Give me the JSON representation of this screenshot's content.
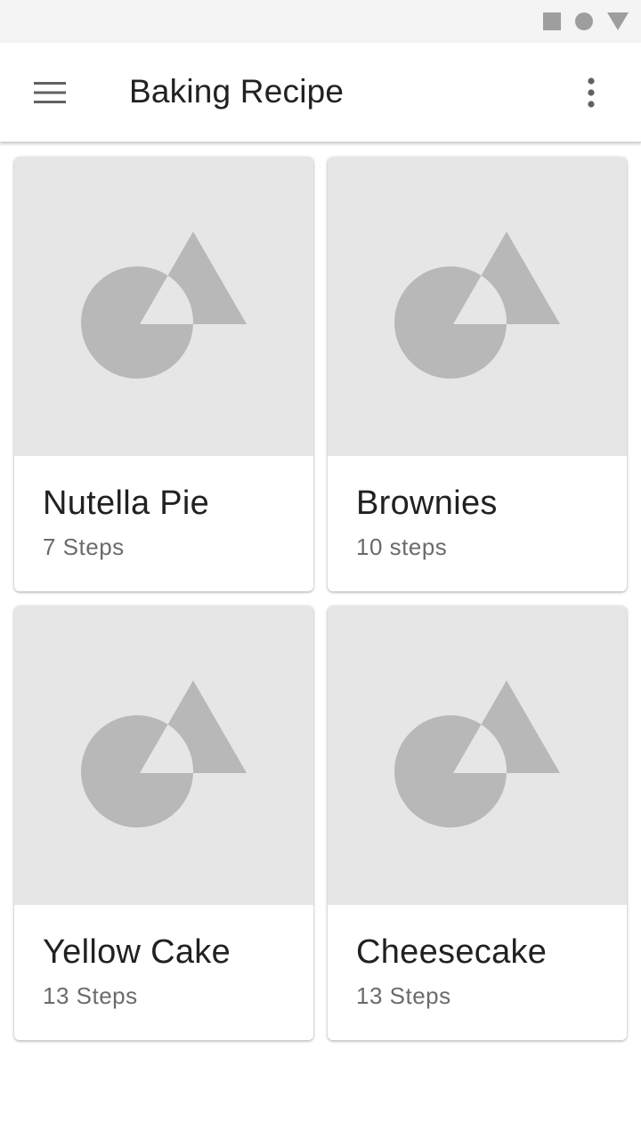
{
  "status_bar": {
    "icons": [
      "square-icon",
      "circle-icon",
      "triangle-icon"
    ],
    "icon_color": "#9e9e9e"
  },
  "app_bar": {
    "title": "Baking Recipe",
    "menu_icon": "hamburger-menu-icon",
    "overflow_icon": "more-vert-icon"
  },
  "recipes": [
    {
      "name": "Nutella Pie",
      "steps": "7 Steps",
      "image_icon": "image-placeholder-icon"
    },
    {
      "name": "Brownies",
      "steps": "10 steps",
      "image_icon": "image-placeholder-icon"
    },
    {
      "name": "Yellow Cake",
      "steps": "13 Steps",
      "image_icon": "image-placeholder-icon"
    },
    {
      "name": "Cheesecake",
      "steps": "13 Steps",
      "image_icon": "image-placeholder-icon"
    }
  ],
  "colors": {
    "placeholder_bg": "#e6e6e6",
    "placeholder_shape": "#b8b8b8",
    "title_text": "#212121",
    "subtitle_text": "#6b6b6b"
  }
}
